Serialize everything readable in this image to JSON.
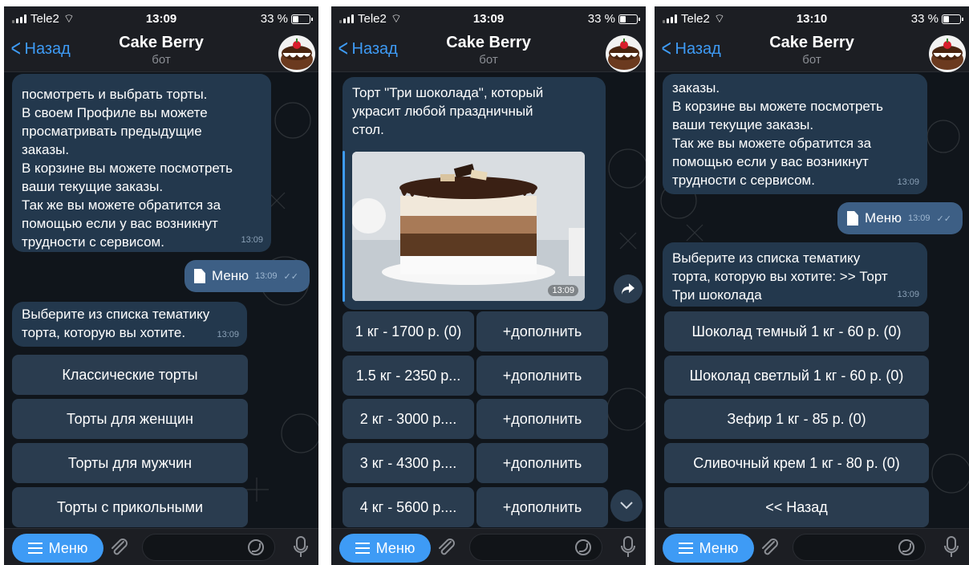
{
  "phones": [
    {
      "status": {
        "carrier": "Tele2",
        "time": "13:09",
        "battery": "33 %"
      },
      "nav": {
        "back": "Назад",
        "title": "Cake Berry",
        "subtitle": "бот"
      },
      "intro_msg": {
        "lines": [
          "посмотреть и выбрать торты.",
          "В своем Профиле вы можете",
          "просматривать предыдущие",
          "заказы.",
          "В корзине вы можете посмотреть",
          "ваши текущие заказы.",
          "Так же вы можете обратится за",
          "помощью если у вас возникнут",
          "трудности с сервисом."
        ],
        "time": "13:09"
      },
      "out_msg": {
        "text": "Меню",
        "time": "13:09"
      },
      "prompt_msg": {
        "lines": [
          "Выберите из списка тематику",
          "торта, которую вы хотите."
        ],
        "time": "13:09"
      },
      "buttons": [
        "Классические торты",
        "Торты для женщин",
        "Торты для мужчин",
        "Торты с прикольными"
      ],
      "menu_label": "Меню"
    },
    {
      "status": {
        "carrier": "Tele2",
        "time": "13:09",
        "battery": "33 %"
      },
      "nav": {
        "back": "Назад",
        "title": "Cake Berry",
        "subtitle": "бот"
      },
      "cake_msg": {
        "lines": [
          "Торт \"Три шоколада\", который",
          "украсит любой праздничный",
          "стол."
        ],
        "time": "13:09"
      },
      "rows": [
        {
          "weight": "1 кг - 1700 р. (0)",
          "add": "+дополнить"
        },
        {
          "weight": "1.5 кг - 2350 р...",
          "add": "+дополнить"
        },
        {
          "weight": "2 кг - 3000 р....",
          "add": "+дополнить"
        },
        {
          "weight": "3 кг - 4300 р....",
          "add": "+дополнить"
        },
        {
          "weight": "4 кг - 5600 р....",
          "add": "+дополнить"
        }
      ],
      "menu_label": "Меню"
    },
    {
      "status": {
        "carrier": "Tele2",
        "time": "13:10",
        "battery": "33 %"
      },
      "nav": {
        "back": "Назад",
        "title": "Cake Berry",
        "subtitle": "бот"
      },
      "intro_msg": {
        "lines": [
          "заказы.",
          "В корзине вы можете посмотреть",
          "ваши текущие заказы.",
          "Так же вы можете обратится за",
          "помощью если у вас возникнут",
          "трудности с сервисом."
        ],
        "time": "13:09"
      },
      "out_msg": {
        "text": "Меню",
        "time": "13:09"
      },
      "prompt_msg": {
        "lines": [
          "Выберите из списка тематику",
          "торта, которую вы хотите: >> Торт",
          "Три шоколада"
        ],
        "time": "13:09"
      },
      "buttons": [
        "Шоколад темный 1 кг - 60 р. (0)",
        "Шоколад светлый 1 кг - 60 р. (0)",
        "Зефир 1 кг - 85 р. (0)",
        "Сливочный крем 1 кг - 80 р. (0)",
        "<< Назад"
      ],
      "menu_label": "Меню"
    }
  ]
}
